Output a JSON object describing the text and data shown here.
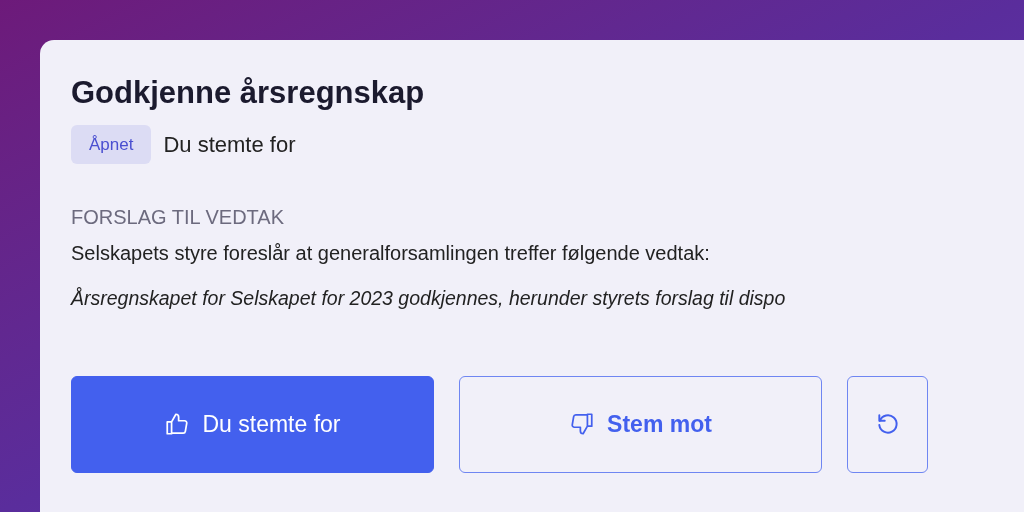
{
  "proposal": {
    "title": "Godkjenne årsregnskap",
    "status_badge": "Åpnet",
    "vote_status": "Du stemte for",
    "section_label": "FORSLAG TIL VEDTAK",
    "intro": "Selskapets styre foreslår at generalforsamlingen treffer følgende vedtak:",
    "resolution": "Årsregnskapet for Selskapet for 2023 godkjennes, herunder styrets forslag til dispo"
  },
  "vote_buttons": [
    {
      "kind": "for",
      "label": "Du stemte for",
      "selected": true
    },
    {
      "kind": "against",
      "label": "Stem mot",
      "selected": false
    },
    {
      "kind": "reset",
      "selected": false
    }
  ]
}
